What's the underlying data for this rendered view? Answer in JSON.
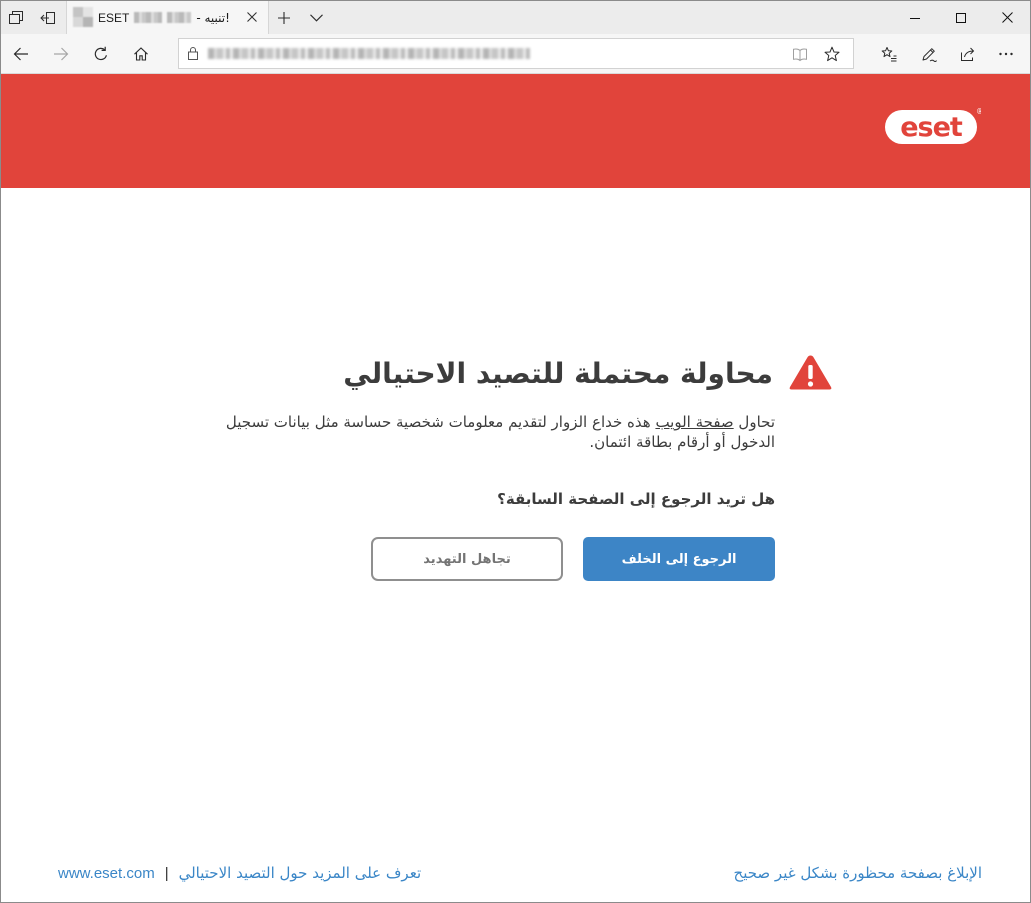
{
  "browser": {
    "tabbar_icons": [
      "tab-list-icon",
      "set-aside-tabs-icon"
    ],
    "tab": {
      "favicon": "redacted-favicon",
      "title_brand": "ESET",
      "title_suffix": "- تنبيه!",
      "close_icon": "close-icon"
    },
    "new_tab_icon": "plus-icon",
    "tab_menu_icon": "chevron-down-icon",
    "window_controls": [
      "minimize-icon",
      "maximize-icon",
      "close-icon"
    ],
    "nav_icons": [
      "back-arrow-icon",
      "forward-arrow-icon",
      "refresh-icon",
      "home-icon"
    ],
    "address_bar": {
      "secure_icon": "lock-icon",
      "icons": [
        "reading-view-icon",
        "favorite-star-icon"
      ]
    },
    "toolbar_icons": [
      "favorites-hub-icon",
      "web-note-pen-icon",
      "share-icon",
      "more-icon"
    ]
  },
  "page": {
    "logo": {
      "text": "eset",
      "trademark": "®"
    },
    "warning_icon": "warning-triangle-icon",
    "heading": "محاولة محتملة للتصيد الاحتيالي",
    "description": {
      "before": "تحاول ",
      "link": "صفحة الويب",
      "after": " هذه خداع الزوار لتقديم معلومات شخصية حساسة مثل بيانات تسجيل الدخول أو أرقام بطاقة ائتمان."
    },
    "question": "هل تريد الرجوع إلى الصفحة السابقة؟",
    "buttons": {
      "back": "الرجوع إلى الخلف",
      "ignore": "تجاهل التهديد"
    },
    "footer": {
      "site": "www.eset.com",
      "separator": "|",
      "learn_more": "تعرف على المزيد حول التصيد الاحتيالي",
      "report": "الإبلاغ بصفحة محظورة بشكل غير صحيح"
    }
  },
  "colors": {
    "header_red": "#e1443b",
    "primary_button": "#3d85c6",
    "link": "#3a86c7",
    "text": "#3c3c3c"
  }
}
